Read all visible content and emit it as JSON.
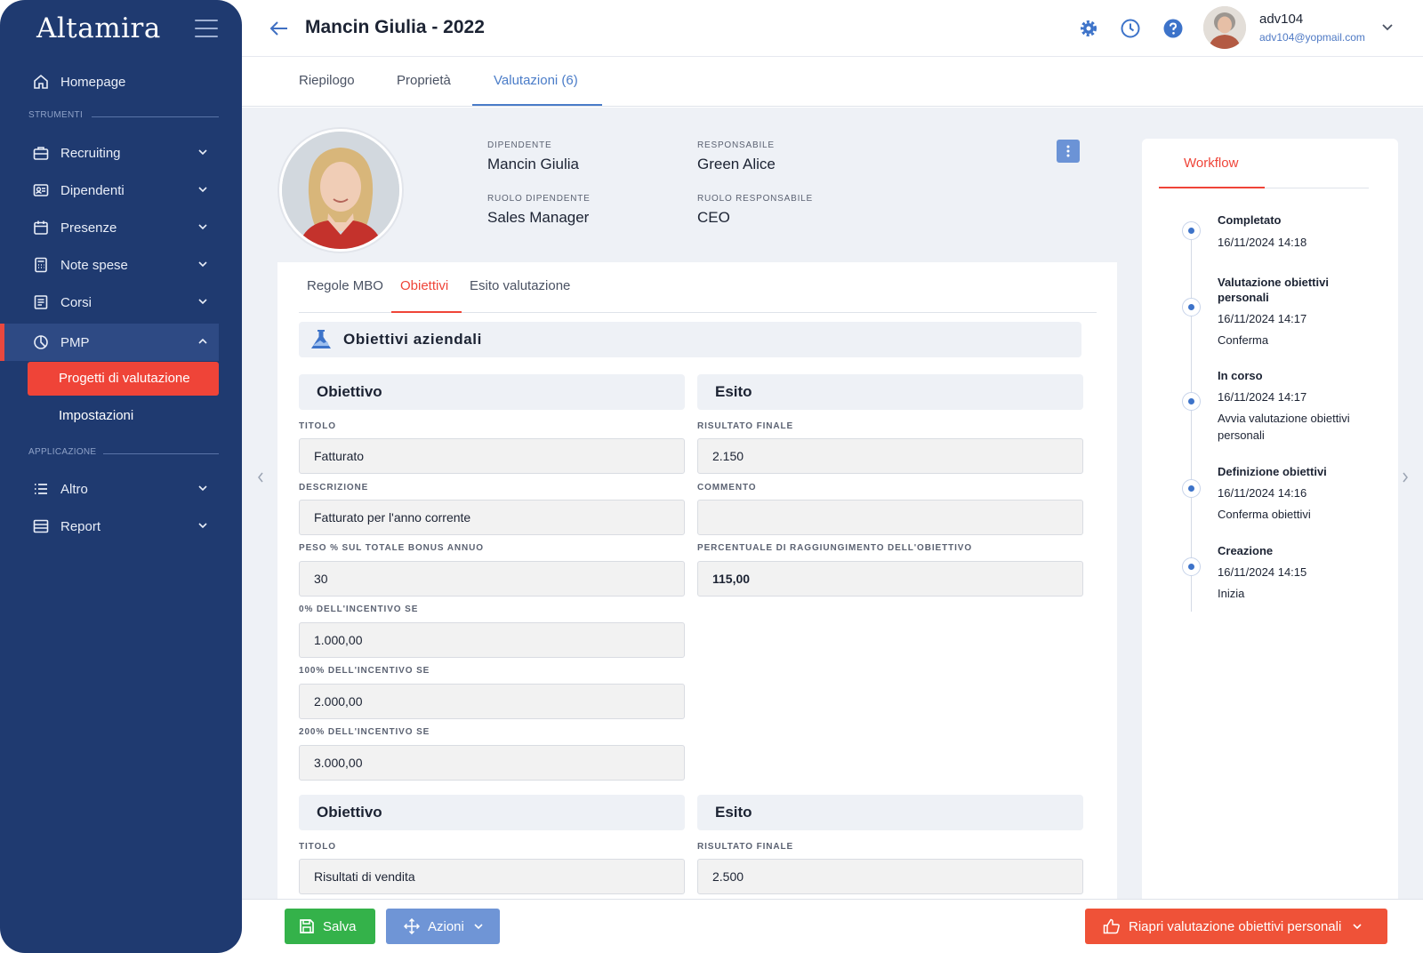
{
  "app": {
    "brand": "Altamira"
  },
  "sidebar": {
    "items": [
      {
        "label": "Homepage",
        "icon": "home-icon"
      },
      {
        "label": "Recruiting",
        "icon": "briefcase-icon"
      },
      {
        "label": "Dipendenti",
        "icon": "id-card-icon"
      },
      {
        "label": "Presenze",
        "icon": "calendar-icon"
      },
      {
        "label": "Note spese",
        "icon": "calculator-icon"
      },
      {
        "label": "Corsi",
        "icon": "book-icon"
      },
      {
        "label": "PMP",
        "icon": "pie-chart-icon"
      },
      {
        "label": "Altro",
        "icon": "list-icon"
      },
      {
        "label": "Report",
        "icon": "report-icon"
      }
    ],
    "sections": {
      "tools": "STRUMENTI",
      "application": "APPLICAZIONE"
    },
    "pmp_sub": [
      {
        "label": "Progetti di valutazione"
      },
      {
        "label": "Impostazioni"
      }
    ]
  },
  "header": {
    "title": "Mancin Giulia - 2022",
    "user": {
      "name": "adv104",
      "email": "adv104@yopmail.com"
    },
    "icons": [
      "settings-icon",
      "clock-icon",
      "help-icon"
    ]
  },
  "tabs": [
    {
      "label": "Riepilogo"
    },
    {
      "label": "Proprietà"
    },
    {
      "label": "Valutazioni (6)"
    }
  ],
  "employee": {
    "dipendente_label": "DIPENDENTE",
    "dipendente": "Mancin Giulia",
    "responsabile_label": "RESPONSABILE",
    "responsabile": "Green Alice",
    "ruolo_dip_label": "RUOLO DIPENDENTE",
    "ruolo_dip": "Sales Manager",
    "ruolo_resp_label": "RUOLO RESPONSABILE",
    "ruolo_resp": "CEO"
  },
  "subtabs": [
    {
      "label": "Regole MBO"
    },
    {
      "label": "Obiettivi"
    },
    {
      "label": "Esito valutazione"
    }
  ],
  "section": {
    "title": "Obiettivi aziendali"
  },
  "objectives": [
    {
      "obiettivo_header": "Obiettivo",
      "esito_header": "Esito",
      "titolo_label": "TITOLO",
      "titolo": "Fatturato",
      "descrizione_label": "DESCRIZIONE",
      "descrizione": "Fatturato per l'anno corrente",
      "peso_label": "PESO % SUL TOTALE BONUS ANNUO",
      "peso": "30",
      "inc0_label": "0% DELL'INCENTIVO SE",
      "inc0": "1.000,00",
      "inc100_label": "100% DELL'INCENTIVO SE",
      "inc100": "2.000,00",
      "inc200_label": "200% DELL'INCENTIVO SE",
      "inc200": "3.000,00",
      "risultato_label": "RISULTATO FINALE",
      "risultato": "2.150",
      "commento_label": "COMMENTO",
      "commento": "",
      "percentuale_label": "PERCENTUALE DI RAGGIUNGIMENTO DELL'OBIETTIVO",
      "percentuale": "115,00"
    },
    {
      "obiettivo_header": "Obiettivo",
      "esito_header": "Esito",
      "titolo_label": "TITOLO",
      "titolo": "Risultati di vendita",
      "risultato_label": "RISULTATO FINALE",
      "risultato": "2.500"
    }
  ],
  "workflow": {
    "tab": "Workflow",
    "steps": [
      {
        "title": "Completato",
        "date": "16/11/2024 14:18",
        "note": ""
      },
      {
        "title": "Valutazione obiettivi personali",
        "date": "16/11/2024 14:17",
        "note": "Conferma"
      },
      {
        "title": "In corso",
        "date": "16/11/2024 14:17",
        "note": "Avvia valutazione obiettivi personali"
      },
      {
        "title": "Definizione obiettivi",
        "date": "16/11/2024 14:16",
        "note": "Conferma obiettivi"
      },
      {
        "title": "Creazione",
        "date": "16/11/2024 14:15",
        "note": "Inizia"
      }
    ]
  },
  "actions": {
    "save": "Salva",
    "actions": "Azioni",
    "reopen": "Riapri valutazione obiettivi personali"
  },
  "colors": {
    "sidebar": "#1f3a70",
    "accent_red": "#ef4438",
    "accent_blue": "#4a7cc8",
    "save_green": "#34b24a",
    "actions_blue": "#6f95d6"
  }
}
